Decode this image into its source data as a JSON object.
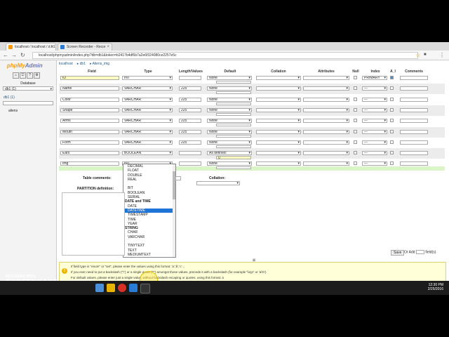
{
  "browser": {
    "tabs": [
      {
        "label": "localhost / localhost / d.b1",
        "active": true
      },
      {
        "label": "Screen Recorder - Recor",
        "active": false
      }
    ],
    "url": "localhost/phpmyadmin/index.php?db=db1&token=b2417b4df6b7a2e6f324080ce2257e5c"
  },
  "pma": {
    "logo_a": "phpMy",
    "logo_b": "Admin",
    "database_label": "Database",
    "database_value": "db1 (1)",
    "db_link": "db1 (1)",
    "table_link": "aliens",
    "breadcrumb": [
      "localhost",
      "db1",
      "Aliens_img"
    ],
    "headers": {
      "name": "Field",
      "type": "Type",
      "length": "Length/Values",
      "default": "Default",
      "collation": "Collation",
      "attributes": "Attributes",
      "null": "Null",
      "index": "Index",
      "ai": "A_I",
      "comments": "Comments"
    },
    "rows": [
      {
        "name": "ID",
        "type": "INT",
        "length": "",
        "default": "None",
        "index": "PRIMARY"
      },
      {
        "name": "Name",
        "type": "VARCHAR",
        "length": "225",
        "default": "None",
        "index": "---"
      },
      {
        "name": "Color",
        "type": "VARCHAR",
        "length": "225",
        "default": "None",
        "index": "---"
      },
      {
        "name": "Shape",
        "type": "VARCHAR",
        "length": "225",
        "default": "None",
        "index": "---"
      },
      {
        "name": "Arms",
        "type": "VARCHAR",
        "length": "225",
        "default": "None",
        "index": "---"
      },
      {
        "name": "Mouth",
        "type": "VARCHAR",
        "length": "225",
        "default": "None",
        "index": "---"
      },
      {
        "name": "Form",
        "type": "VARCHAR",
        "length": "225",
        "default": "None",
        "index": "---"
      },
      {
        "name": "Ears",
        "type": "BOOLEAN",
        "length": "",
        "default": "As defined:",
        "default_value": "0",
        "index": "---"
      },
      {
        "name": "Img",
        "type": "INT",
        "length": "",
        "default": "None",
        "index": "---"
      }
    ],
    "type_options": [
      {
        "label": "DECIMAL",
        "group": false
      },
      {
        "label": "FLOAT",
        "group": false
      },
      {
        "label": "DOUBLE",
        "group": false
      },
      {
        "label": "REAL",
        "group": false
      },
      {
        "label": "",
        "group": false
      },
      {
        "label": "BIT",
        "group": false
      },
      {
        "label": "BOOLEAN",
        "group": false
      },
      {
        "label": "SERIAL",
        "group": false
      },
      {
        "label": "DATE and TIME",
        "group": true
      },
      {
        "label": "DATE",
        "group": false
      },
      {
        "label": "DATETIME",
        "group": false,
        "selected": true
      },
      {
        "label": "TIMESTAMP",
        "group": false
      },
      {
        "label": "TIME",
        "group": false
      },
      {
        "label": "YEAR",
        "group": false
      },
      {
        "label": "STRING",
        "group": true
      },
      {
        "label": "CHAR",
        "group": false
      },
      {
        "label": "VARCHAR",
        "group": false
      },
      {
        "label": "",
        "group": false
      },
      {
        "label": "TINYTEXT",
        "group": false
      },
      {
        "label": "TEXT",
        "group": false
      },
      {
        "label": "MEDIUMTEXT",
        "group": false
      }
    ],
    "table_comments_label": "Table comments:",
    "collation_label": "Collation:",
    "partition_label": "PARTITION definition:",
    "save_label": "Save",
    "or_add_label": "Or Add",
    "fields_label": "field(s)",
    "notes": [
      "If field type is \"enum\" or \"set\", please enter the values using this format: 'a','b','c'...",
      "If you ever need to put a backslash (\"\\\") or a single quote (\"'\") amongst those values, precede it with a backslash (for example '\\\\xyz' or 'a\\'b').",
      "For default values, please enter just a single value, without backslash escaping or quotes, using this format: a"
    ]
  },
  "watermark": {
    "line1": "RECORDED WITH",
    "line2": "SCREENCAST-O-MATIC"
  },
  "taskbar": {
    "time": "12:30 PM",
    "date": "2/25/2016"
  }
}
